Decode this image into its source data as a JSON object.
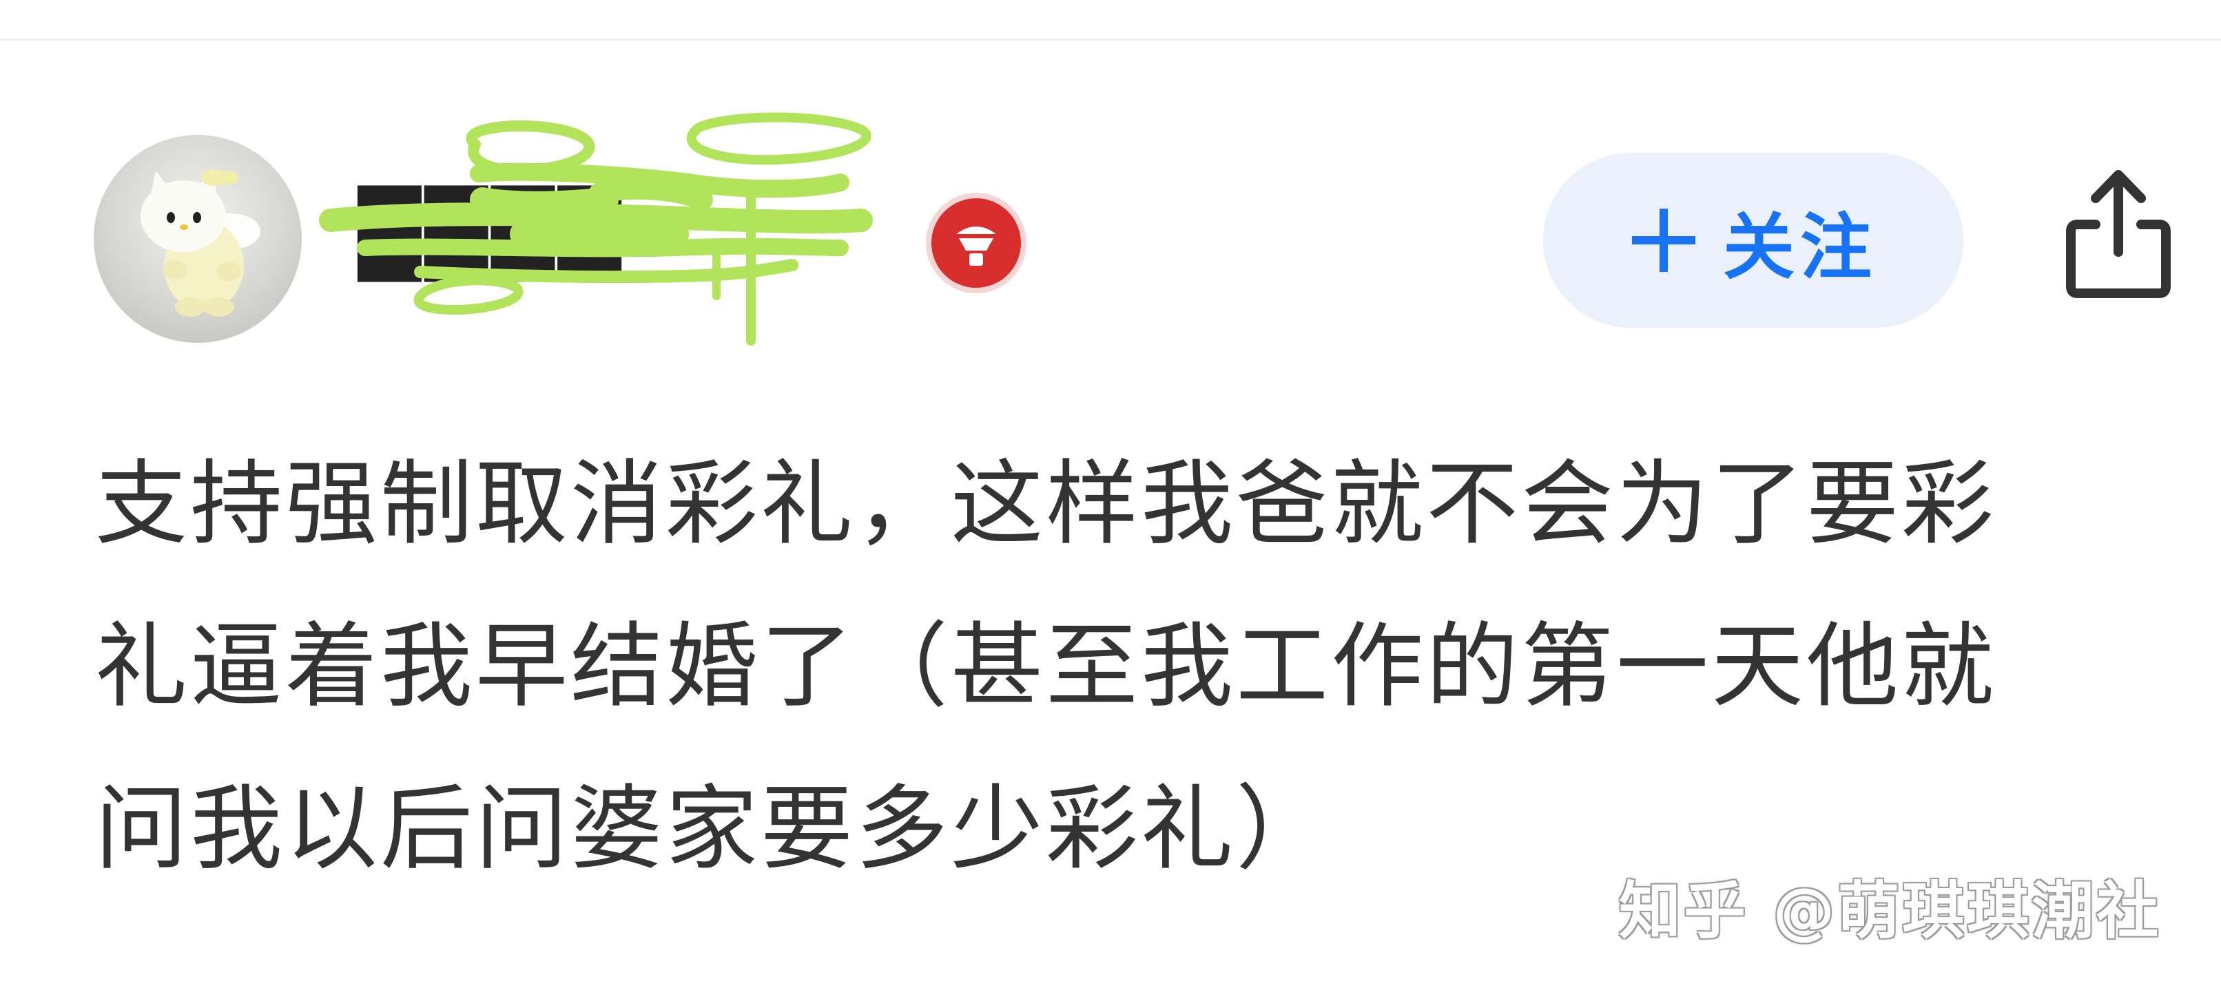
{
  "header": {
    "avatar_icon": "hello-kitty-angel-avatar",
    "username_obscured": "████",
    "badge_icon": "red-cup-badge-icon",
    "follow_button": {
      "icon": "plus-icon",
      "label": "关注"
    },
    "share_icon": "share-icon"
  },
  "post": {
    "lines": [
      "支持强制取消彩礼，这样我爸就不会为了要彩",
      "礼逼着我早结婚了（甚至我工作的第一天他就",
      "问我以后问婆家要多少彩礼）"
    ]
  },
  "watermark": "知乎 @萌琪琪潮社",
  "colors": {
    "accent_blue": "#1772f6",
    "follow_bg": "#eaf1fd",
    "scribble_green": "#b1e35b",
    "badge_red": "#d82d2d",
    "text": "#333333"
  }
}
